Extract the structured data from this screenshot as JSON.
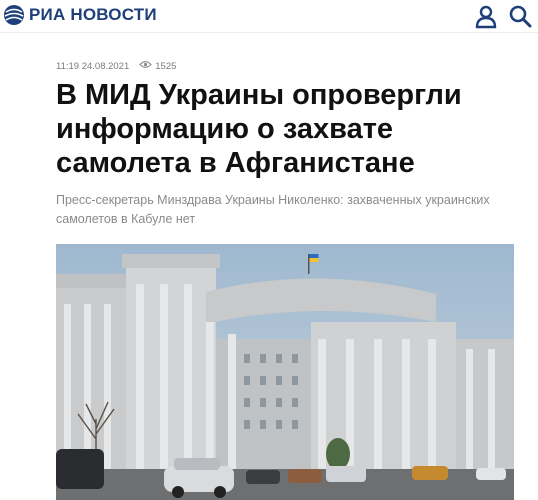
{
  "header": {
    "logo_text": "РИА НОВОСТИ",
    "logo_icon": "ria-globe-logo",
    "user_icon": "user-icon",
    "search_icon": "search-icon",
    "brand_color": "#1f3f7a"
  },
  "article": {
    "time": "11:19 24.08.2021",
    "views": "1525",
    "views_icon": "eye-icon",
    "title": "В МИД Украины опровергли информацию о захвате самолета в Афганистане",
    "subtitle": "Пресс-секретарь Минздрава Украины Николенко: захваченных украинских самолетов в Кабуле нет",
    "image": "photo-ministry-building"
  }
}
